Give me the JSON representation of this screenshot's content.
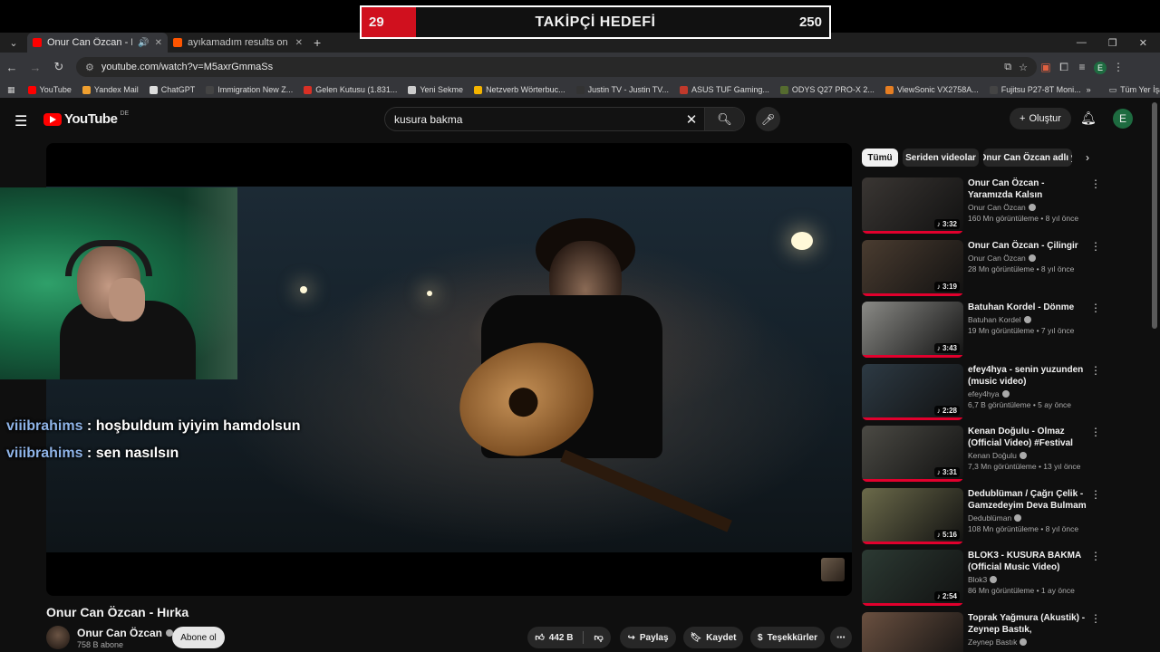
{
  "goal": {
    "current": "29",
    "title": "TAKİPÇİ HEDEFİ",
    "target": "250",
    "progress_fraction": 0.116
  },
  "tabs": [
    {
      "title": "Onur Can Özcan - Hırka - Yo",
      "active": true,
      "color": "#ff0000"
    },
    {
      "title": "ayıkamadım results on SoundC",
      "active": false,
      "color": "#ff5500"
    }
  ],
  "address": {
    "url": "youtube.com/watch?v=M5axrGmmaSs"
  },
  "bookmarks": [
    {
      "label": "YouTube",
      "color": "#ff0000"
    },
    {
      "label": "Yandex Mail",
      "color": "#f0a030"
    },
    {
      "label": "ChatGPT",
      "color": "#dddddd"
    },
    {
      "label": "Immigration New Z...",
      "color": "#444444"
    },
    {
      "label": "Gelen Kutusu (1.831...",
      "color": "#d93025"
    },
    {
      "label": "Yeni Sekme",
      "color": "#cccccc"
    },
    {
      "label": "Netzverb Wörterbuc...",
      "color": "#f4b400"
    },
    {
      "label": "Justin TV - Justin TV...",
      "color": "#333333"
    },
    {
      "label": "ASUS TUF Gaming...",
      "color": "#c0392b"
    },
    {
      "label": "ODYS Q27 PRO-X 2...",
      "color": "#556b2f"
    },
    {
      "label": "ViewSonic VX2758A...",
      "color": "#e67e22"
    },
    {
      "label": "Fujitsu P27-8T Moni...",
      "color": "#444444"
    }
  ],
  "bookmarks_all": "Tüm Yer İşaretleri",
  "youtube": {
    "logo_text": "YouTube",
    "country": "DE",
    "search_value": "kusura bakma",
    "create_label": "Oluştur",
    "avatar_letter": "E"
  },
  "chat": [
    {
      "user": "viiibrahims",
      "message": " : hoşbuldum iyiyim hamdolsun"
    },
    {
      "user": "viiibrahims",
      "message": " : sen nasılsın"
    }
  ],
  "video": {
    "title": "Onur Can Özcan - Hırka",
    "channel": "Onur Can Özcan",
    "subscribers": "758 B abone",
    "subscribe_label": "Abone ol",
    "likes": "442 B",
    "share_label": "Paylaş",
    "save_label": "Kaydet",
    "thanks_label": "Teşekkürler"
  },
  "chips": [
    "Tümü",
    "Seriden videolar",
    "Onur Can Özcan adlı y"
  ],
  "recommendations": [
    {
      "title": "Onur Can Özcan - Yaramızda Kalsın",
      "channel": "Onur Can Özcan",
      "meta": "160 Mn görüntüleme • 8 yıl önce",
      "duration": "3:32",
      "bg": "#3a3633"
    },
    {
      "title": "Onur Can Özcan - Çilingir",
      "channel": "Onur Can Özcan",
      "meta": "28 Mn görüntüleme • 8 yıl önce",
      "duration": "3:19",
      "bg": "#4a3c30"
    },
    {
      "title": "Batuhan Kordel - Dönme",
      "channel": "Batuhan Kordel",
      "meta": "19 Mn görüntüleme • 7 yıl önce",
      "duration": "3:43",
      "bg": "#8a8a86"
    },
    {
      "title": "efey4hya - senin yuzunden (music video)",
      "channel": "efey4hya",
      "meta": "6,7 B görüntüleme • 5 ay önce",
      "duration": "2:28",
      "bg": "#2d3a44"
    },
    {
      "title": "Kenan Doğulu - Olmaz (Official Video) #Festival",
      "channel": "Kenan Doğulu",
      "meta": "7,3 Mn görüntüleme • 13 yıl önce",
      "duration": "3:31",
      "bg": "#4b4a44"
    },
    {
      "title": "Dedublüman / Çağrı Çelik - Gamzedeyim Deva Bulmam",
      "channel": "Dedublüman",
      "meta": "108 Mn görüntüleme • 8 yıl önce",
      "duration": "5:16",
      "bg": "#6b6a4a"
    },
    {
      "title": "BLOK3 - KUSURA BAKMA (Official Music Video)",
      "channel": "Blok3",
      "meta": "86 Mn görüntüleme • 1 ay önce",
      "duration": "2:54",
      "bg": "#2c3a33"
    },
    {
      "title": "Toprak Yağmura (Akustik) - Zeynep Bastık, @canozzano",
      "channel": "Zeynep Bastık",
      "meta": "",
      "duration": "",
      "bg": "#6a5040"
    }
  ]
}
